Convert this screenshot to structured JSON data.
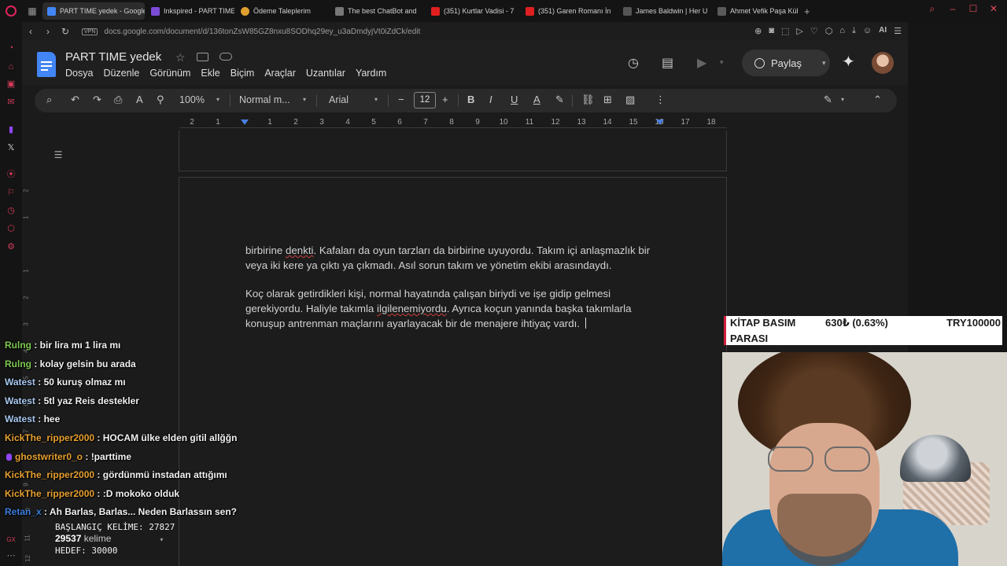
{
  "browser": {
    "tabs": [
      {
        "title": "PART TIME yedek - Google",
        "favicon_color": "#4285f4",
        "active": true
      },
      {
        "title": "Inkspired - PART TIME",
        "favicon_color": "#7b4bd6",
        "active": false
      },
      {
        "title": "Ödeme Taleplerim",
        "favicon_color": "#e0a030",
        "active": false
      },
      {
        "title": "The best ChatBot and",
        "favicon_color": "#777777",
        "active": false
      },
      {
        "title": "(351) Kurtlar Vadisi - 7",
        "favicon_color": "#e02020",
        "active": false
      },
      {
        "title": "(351) Garen Romanı İn",
        "favicon_color": "#e02020",
        "active": false
      },
      {
        "title": "James Baldwin | Her U",
        "favicon_color": "#555555",
        "active": false
      },
      {
        "title": "Ahmet Vefik Paşa Kültü",
        "favicon_color": "#5a5a5a",
        "active": false
      }
    ],
    "new_tab": "+",
    "url": "docs.google.com/document/d/136tonZsW85GZ8nxu8SODhq29ey_u3aDmdyjVt0iZdCk/edit",
    "vpn_label": "VPN",
    "ai_label": "AI"
  },
  "docs": {
    "title": "PART TIME  yedek",
    "menu": [
      "Dosya",
      "Düzenle",
      "Görünüm",
      "Ekle",
      "Biçim",
      "Araçlar",
      "Uzantılar",
      "Yardım"
    ],
    "share_label": "Paylaş",
    "toolbar": {
      "zoom": "100%",
      "style": "Normal m...",
      "font": "Arial",
      "font_size": "12"
    },
    "ruler_labels": [
      "2",
      "1",
      "1",
      "2",
      "3",
      "4",
      "5",
      "6",
      "7",
      "8",
      "9",
      "10",
      "11",
      "12",
      "13",
      "14",
      "15",
      "16",
      "17",
      "18"
    ],
    "vertical_ruler": [
      "2",
      "1",
      "1",
      "2",
      "3",
      "4",
      "5",
      "6",
      "7",
      "8",
      "9",
      "10",
      "11",
      "12"
    ],
    "paragraph1": {
      "pre": "birbirine ",
      "misspelled": "denkti",
      "post": ". Kafaları da oyun tarzları da birbirine uyuyordu. Takım içi anlaşmazlık bir veya iki kere ya çıktı ya çıkmadı. Asıl sorun takım ve yönetim ekibi arasındaydı."
    },
    "paragraph2": {
      "pre": "Koç olarak getirdikleri kişi, normal hayatında çalışan biriydi ve işe gidip gelmesi gerekiyordu. Haliyle takımla ",
      "misspelled": "ilgilenemiyordu",
      "post": ". Ayrıca koçun yanında başka takımlarla konuşup antrenman maçlarını ayarlayacak bir de menajere ihtiyaç vardı. "
    }
  },
  "chat": [
    {
      "user": "Rulng",
      "color": "#7ec850",
      "message": ": bir lira mı 1 lira mı"
    },
    {
      "user": "Rulng",
      "color": "#7ec850",
      "message": ": kolay gelsin bu arada"
    },
    {
      "user": "Watest",
      "color": "#a8c8f0",
      "message": ": 50 kuruş olmaz mı"
    },
    {
      "user": "Watest",
      "color": "#a8c8f0",
      "message": ": 5tl yaz Reis destekler"
    },
    {
      "user": "Watest",
      "color": "#a8c8f0",
      "message": ": hee"
    },
    {
      "user": "KickThe_ripper2000",
      "color": "#e8a030",
      "message": ": HOCAM ülke elden gitil allğğn"
    },
    {
      "user": "ghostwriter0_o",
      "color": "#e8a030",
      "message": ": !parttime",
      "badge": true
    },
    {
      "user": "KickThe_ripper2000",
      "color": "#e8a030",
      "message": ": gördünmü instadan attığımı"
    },
    {
      "user": "KickThe_ripper2000",
      "color": "#e8a030",
      "message": ": :D mokoko olduk"
    },
    {
      "user": "Retan_x",
      "color": "#3b7ddd",
      "message": ": Ah Barlas, Barlas... Neden Barlassın sen?"
    }
  ],
  "counter": {
    "start": "BAŞLANGIÇ KELİME: 27827",
    "count": "29537",
    "count_unit": "kelime",
    "goal": "HEDEF: 30000"
  },
  "ticker": {
    "label_line1": "KİTAP BASIM",
    "label_line2": "PARASI",
    "percent": "630₺ (0.63%)",
    "goal": "TRY100000"
  },
  "colors": {
    "accent": "#4285f4",
    "opera_red": "#e0245e",
    "ticker_red": "#d0203c"
  }
}
